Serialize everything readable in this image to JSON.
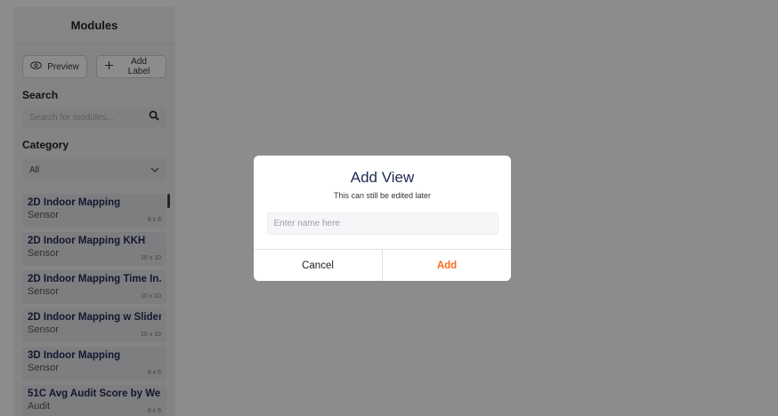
{
  "sidebar": {
    "title": "Modules",
    "preview_label": "Preview",
    "add_label_label": "Add Label",
    "search_heading": "Search",
    "search_placeholder": "Search for modules...",
    "category_heading": "Category",
    "category_selected": "All",
    "items": [
      {
        "name": "2D Indoor Mapping",
        "category": "Sensor",
        "size": "8 x 8"
      },
      {
        "name": "2D Indoor Mapping KKH",
        "category": "Sensor",
        "size": "10 x 10"
      },
      {
        "name": "2D Indoor Mapping Time In...",
        "category": "Sensor",
        "size": "10 x 10"
      },
      {
        "name": "2D Indoor Mapping w Slider",
        "category": "Sensor",
        "size": "10 x 10"
      },
      {
        "name": "3D Indoor Mapping",
        "category": "Sensor",
        "size": "8 x 6"
      },
      {
        "name": "51C Avg Audit Score by We...",
        "category": "Audit",
        "size": "8 x 6"
      }
    ]
  },
  "modal": {
    "title": "Add View",
    "subtitle": "This can still be edited later",
    "input_placeholder": "Enter name here",
    "cancel_label": "Cancel",
    "add_label": "Add"
  },
  "colors": {
    "accent": "#ff6a1a",
    "title": "#1f2a55"
  }
}
